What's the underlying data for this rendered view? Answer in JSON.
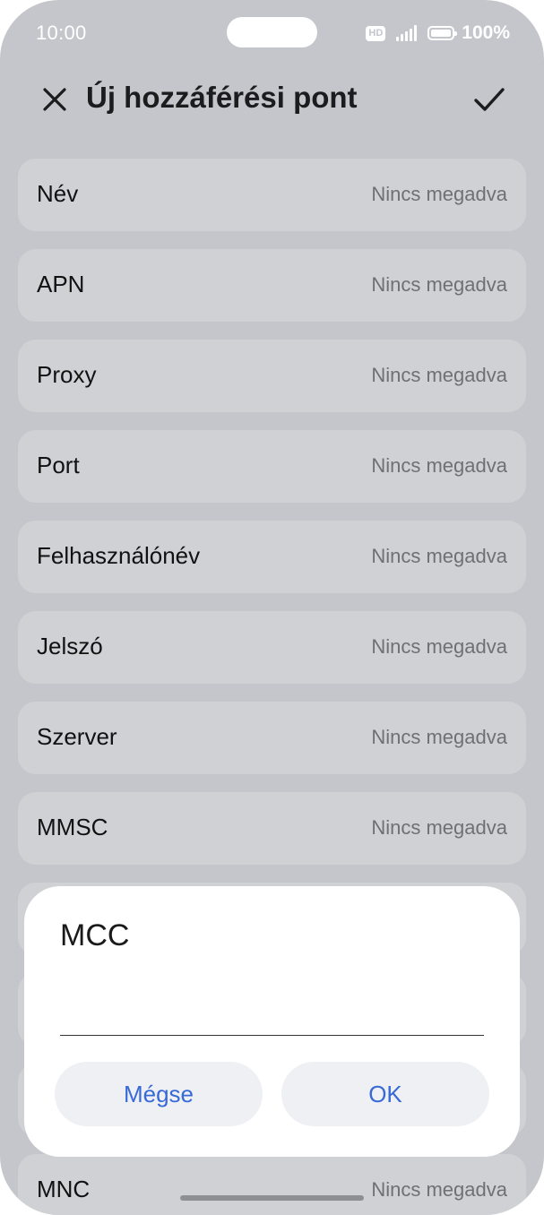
{
  "status_bar": {
    "time": "10:00",
    "hd_badge": "HD",
    "battery_text": "100%",
    "icons": [
      "hd-icon",
      "signal-icon",
      "battery-icon"
    ]
  },
  "header": {
    "title": "Új hozzáférési pont",
    "close_icon": "close-icon",
    "confirm_icon": "check-icon"
  },
  "settings": [
    {
      "label": "Név",
      "value": "Nincs megadva"
    },
    {
      "label": "APN",
      "value": "Nincs megadva"
    },
    {
      "label": "Proxy",
      "value": "Nincs megadva"
    },
    {
      "label": "Port",
      "value": "Nincs megadva"
    },
    {
      "label": "Felhasználónév",
      "value": "Nincs megadva"
    },
    {
      "label": "Jelszó",
      "value": "Nincs megadva"
    },
    {
      "label": "Szerver",
      "value": "Nincs megadva"
    },
    {
      "label": "MMSC",
      "value": "Nincs megadva"
    },
    {
      "label": "",
      "value": ""
    },
    {
      "label": "",
      "value": ""
    },
    {
      "label": "",
      "value": ""
    },
    {
      "label": "MNC",
      "value": "Nincs megadva"
    }
  ],
  "dialog": {
    "title": "MCC",
    "input_value": "",
    "cancel_label": "Mégse",
    "ok_label": "OK"
  },
  "colors": {
    "background": "#c5c6cb",
    "row_background": "#d0d1d5",
    "dialog_background": "#ffffff",
    "button_background": "#eff0f4",
    "accent": "#3769d7"
  }
}
